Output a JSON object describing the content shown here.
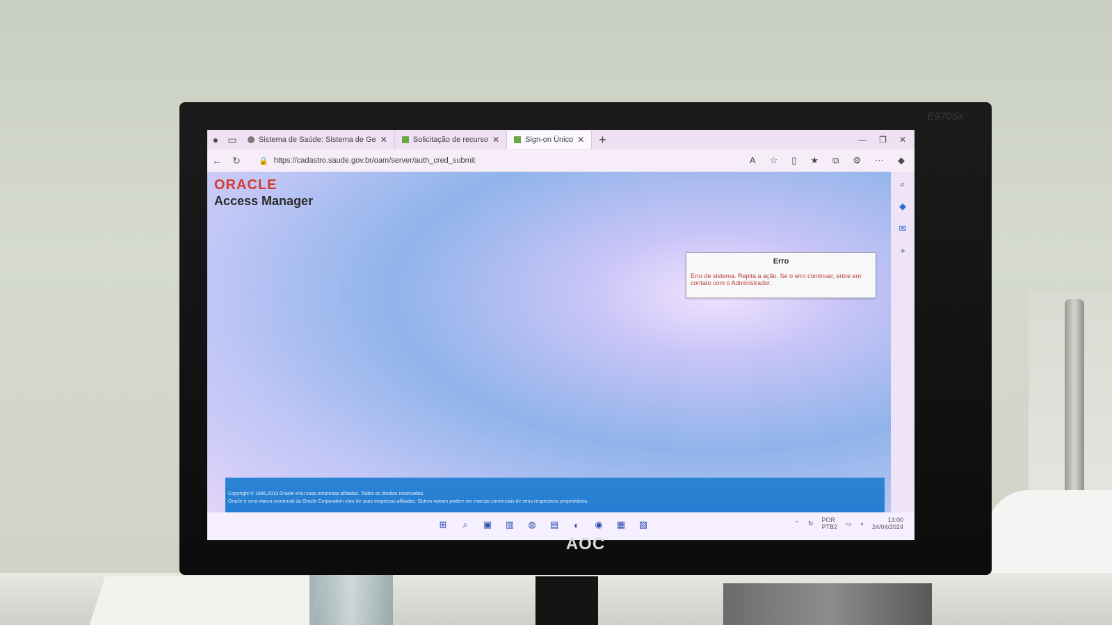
{
  "browser": {
    "tabs": [
      {
        "label": "Sistema de Saúde: Sistema de Ge",
        "active": false
      },
      {
        "label": "Solicitação de recurso",
        "active": false
      },
      {
        "label": "Sign-on Único",
        "active": true
      }
    ],
    "url": "https://cadastro.saude.gov.br/oam/server/auth_cred_submit"
  },
  "page": {
    "logo": "ORACLE",
    "title": "Access Manager",
    "error": {
      "title": "Erro",
      "message": "Erro de sistema. Repita a ação. Se o erro continuar, entre em contato com o Administrador."
    },
    "footer": {
      "line1": "Copyright © 1996,2013 Oracle e/ou suas empresas afiliadas. Todos os direitos reservados.",
      "line2": "Oracle é uma marca comercial da Oracle Corporation e/ou de suas empresas afiliadas. Outros nomes podem ser marcas comerciais de seus respectivos proprietários."
    }
  },
  "taskbar": {
    "language": "POR",
    "keyboard": "PTB2",
    "time": "13:00",
    "date": "24/04/2024"
  },
  "monitor": {
    "brand": "AOC",
    "model": "E970Sx"
  }
}
